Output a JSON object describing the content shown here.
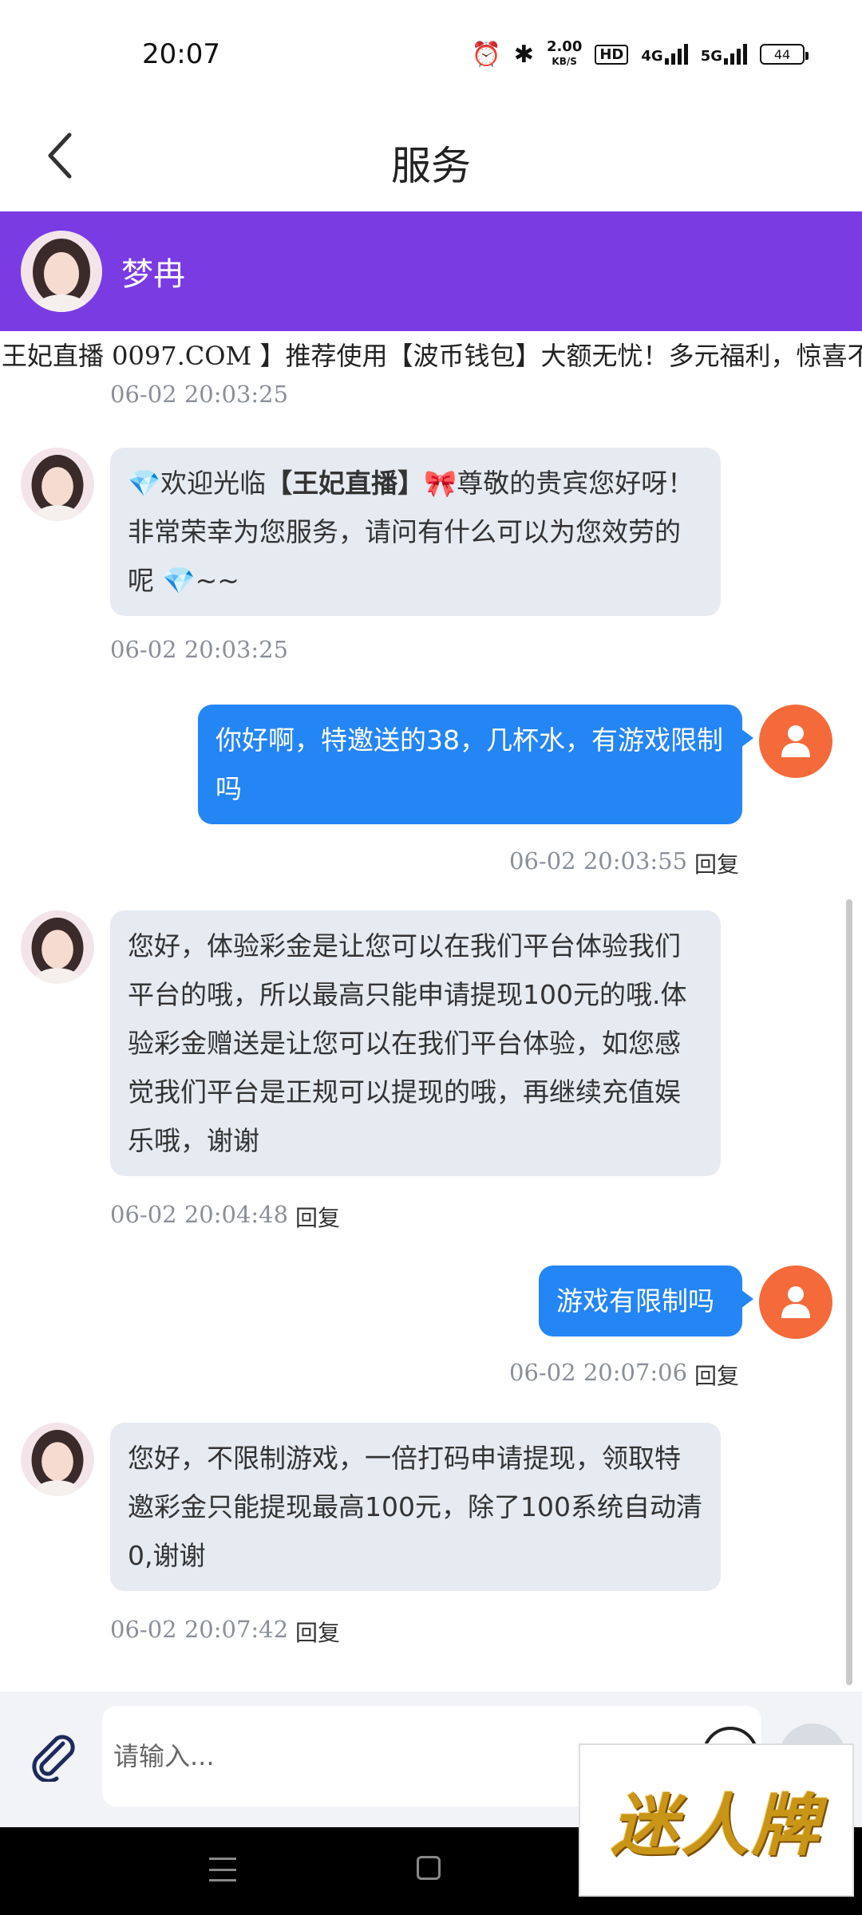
{
  "status_bar": {
    "time": "20:07",
    "speed_value": "2.00",
    "speed_unit": "KB/S",
    "hd_label": "HD",
    "net1": "4G",
    "net2": "5G",
    "battery": "44",
    "icons": [
      "alarm-icon",
      "bluetooth-icon",
      "signal-icon",
      "battery-icon"
    ]
  },
  "header": {
    "title": "服务",
    "back_icon": "chevron-left-icon"
  },
  "agent": {
    "name": "梦冉",
    "bar_color": "#7a3be3"
  },
  "marquee": {
    "text": "王妃直播 0097.COM 】推荐使用【波币钱包】大额无忧！多元福利，惊喜不"
  },
  "chat": {
    "top_timestamp": "06-02 20:03:25",
    "messages": [
      {
        "from": "agent",
        "segments": [
          "💎",
          "欢迎光临",
          "【王妃直播】",
          "🎀",
          "尊敬的贵宾您好呀！非常荣幸为您服务，请问有什么可以为您效劳的呢 ",
          "💎",
          "~~"
        ],
        "time": "06-02 20:03:25",
        "reply": ""
      },
      {
        "from": "user",
        "text": "你好啊，特邀送的38，几杯水，有游戏限制吗",
        "time": "06-02 20:03:55",
        "reply": "回复"
      },
      {
        "from": "agent",
        "text": "您好，体验彩金是让您可以在我们平台体验我们平台的哦，所以最高只能申请提现100元的哦.体验彩金赠送是让您可以在我们平台体验，如您感觉我们平台是正规可以提现的哦，再继续充值娱乐哦，谢谢",
        "time": "06-02 20:04:48",
        "reply": "回复"
      },
      {
        "from": "user",
        "text": "游戏有限制吗",
        "time": "06-02 20:07:06",
        "reply": "回复"
      },
      {
        "from": "agent",
        "text": "您好，不限制游戏，一倍打码申请提现，领取特邀彩金只能提现最高100元，除了100系统自动清0,谢谢",
        "time": "06-02 20:07:42",
        "reply": "回复"
      }
    ],
    "agent_bubble_color": "#e6eaf1",
    "user_bubble_color": "#2485f5",
    "user_avatar_color": "#f46a3b"
  },
  "input": {
    "placeholder": "请输入...",
    "attach_icon": "paperclip-icon",
    "emoji_icon": "emoji-icon",
    "send_icon": "send-icon"
  },
  "watermark": {
    "text": "迷人牌"
  }
}
